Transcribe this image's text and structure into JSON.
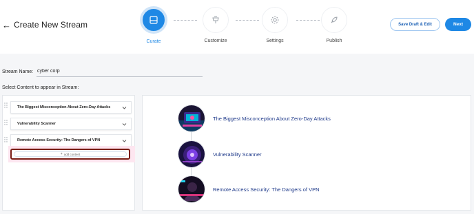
{
  "header": {
    "back_icon": "arrow-left-icon",
    "title": "Create New Stream",
    "save_button": "Save Draft & Edit",
    "next_button": "Next"
  },
  "steps": [
    {
      "label": "Curate",
      "icon": "inbox-icon",
      "active": true
    },
    {
      "label": "Customize",
      "icon": "paint-bucket-icon",
      "active": false
    },
    {
      "label": "Settings",
      "icon": "gear-icon",
      "active": false
    },
    {
      "label": "Publish",
      "icon": "rocket-icon",
      "active": false
    }
  ],
  "form": {
    "stream_name_label": "Stream Name:",
    "stream_name_value": "cyber corp",
    "select_label": "Select Content to appear in Stream:"
  },
  "content_items": [
    {
      "label": "The Biggest Misconception About Zero-Day Attacks"
    },
    {
      "label": "Vulnerability Scanner"
    },
    {
      "label": "Remote Access Security: The Dangers of VPN"
    }
  ],
  "add_content_label": "add content",
  "timeline": [
    {
      "title": "The Biggest Misconception About Zero-Day Attacks"
    },
    {
      "title": "Vulnerability Scanner"
    },
    {
      "title": "Remote Access Security: The Dangers of VPN"
    }
  ],
  "colors": {
    "accent": "#1e88e5",
    "highlight_border": "#7a1e16",
    "timeline_title": "#1f3a8a"
  }
}
